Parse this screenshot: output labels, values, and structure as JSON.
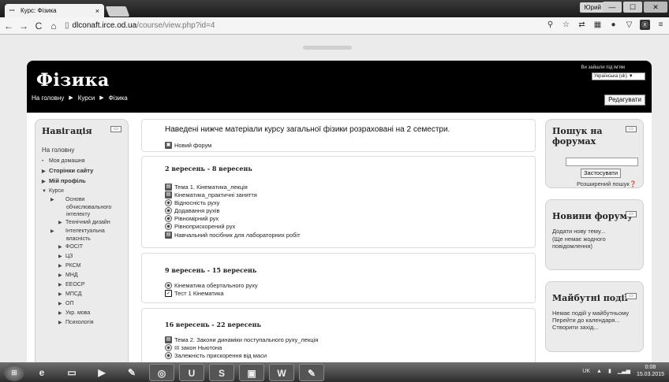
{
  "browser": {
    "tab_title": "Курс: Фізика",
    "url_host": "dlconaft.irce.od.ua",
    "url_path": "/course/view.php?id=4",
    "user_button": "Юрий",
    "window_min": "—",
    "window_max": "☐",
    "window_close": "✕"
  },
  "site": {
    "title": "Фізика",
    "login_info": "Ви зайшли під ім'ям",
    "language_selected": "Українська (uk) ▼",
    "edit_button": "Редагувати"
  },
  "breadcrumb": [
    "На головну",
    "Курси",
    "Фізика"
  ],
  "breadcrumb_sep": "▶",
  "navigation": {
    "title": "Навігація",
    "home": "На головну",
    "items": [
      {
        "label": "Моя домашня",
        "icon": "•"
      },
      {
        "label": "Сторінки сайту",
        "icon": "▶"
      },
      {
        "label": "Мій профіль",
        "icon": "▶"
      },
      {
        "label": "Курси",
        "icon": "▼"
      }
    ],
    "courses": [
      "Основи обчислювального інтелекту",
      "Технічний дизайн",
      "Інтелектуальна власність",
      "ФОСІТ",
      "ЦЗ",
      "РКСМ",
      "МНД",
      "ЕЕОСР",
      "МПСД",
      "ОП",
      "Укр. мова",
      "Психологія"
    ]
  },
  "sections": [
    {
      "summary": "Наведені нижче матеріали курсу загальної фізики розраховані на 2 семестри.",
      "activities": [
        {
          "label": "Новий форум",
          "icon": "forum-icon"
        }
      ]
    },
    {
      "title": "2 вересень - 8 вересень",
      "activities": [
        {
          "label": "Тема 1. Кінематика_лекція",
          "icon": "file-icon"
        },
        {
          "label": "Кінематика_практичні заняття",
          "icon": "file-icon"
        },
        {
          "label": "Відносність руху",
          "icon": "url-icon"
        },
        {
          "label": "Додавання рухів",
          "icon": "url-icon"
        },
        {
          "label": "Рівномірний рух",
          "icon": "url-icon"
        },
        {
          "label": "Рівноприскорений рух",
          "icon": "url-icon"
        },
        {
          "label": "Навчальний посібник для лабораторних робіт",
          "icon": "file-icon"
        }
      ]
    },
    {
      "title": "9 вересень - 15 вересень",
      "activities": [
        {
          "label": "Кінематика обертального руху",
          "icon": "url-icon"
        },
        {
          "label": "Тест 1 Кінематика",
          "icon": "quiz-icon"
        }
      ]
    },
    {
      "title": "16 вересень - 22 вересень",
      "activities": [
        {
          "label": "Тема 2. Закони динаміки поступального руху_лекція",
          "icon": "file-icon"
        },
        {
          "label": "ІІІ закон Ньютона",
          "icon": "url-icon"
        },
        {
          "label": "Залежність прискорення від маси",
          "icon": "url-icon"
        }
      ]
    }
  ],
  "search_forums": {
    "title": "Пошук на форумах",
    "button": "Застосувати",
    "advanced": "Розширений пошук"
  },
  "news": {
    "title": "Новини форуму",
    "add": "Додати нову тему...",
    "empty": "(Ще немає жодного повідомлення)"
  },
  "events": {
    "title": "Майбутні події",
    "none": "Немає подій у майбутньому",
    "calendar": "Перейти до календаря...",
    "new_event": "Створити захід..."
  },
  "taskbar": {
    "lang": "UK",
    "time": "0:08",
    "date": "15.03.2015"
  }
}
